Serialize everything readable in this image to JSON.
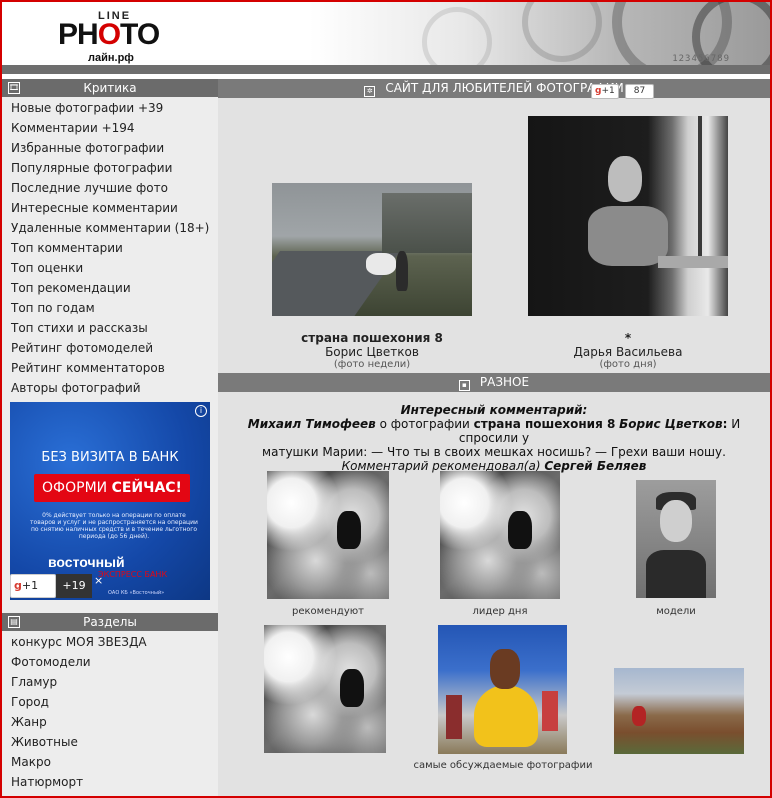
{
  "header": {
    "logo_line": "LINE",
    "logo_photo_left": "PH",
    "logo_photo_o": "O",
    "logo_photo_right": "TO",
    "logo_domain": "лайн.рф",
    "header_numbers": "123456789"
  },
  "sidebar": {
    "critique_title": "Критика",
    "critique_items": [
      "Новые фотографии +39",
      "Комментарии +194",
      "Избранные фотографии",
      "Популярные фотографии",
      "Последние лучшие фото",
      "Интересные комментарии",
      "Удаленные комментарии (18+)",
      "Топ комментарии",
      "Топ оценки",
      "Топ рекомендации",
      "Топ по годам",
      "Топ стихи и рассказы",
      "Рейтинг фотомоделей",
      "Рейтинг комментаторов",
      "Авторы фотографий"
    ],
    "sections_title": "Разделы",
    "section_items": [
      "конкурс МОЯ ЗВЕЗДА",
      "Фотомодели",
      "Гламур",
      "Город",
      "Жанр",
      "Животные",
      "Макро",
      "Натюрморт"
    ]
  },
  "ad": {
    "headline": "БЕЗ ВИЗИТА В БАНК",
    "button_normal": "ОФОРМИ ",
    "button_bold": "СЕЙЧАС!",
    "fine_print": "0% действует только на операции по оплате товаров и услуг и не распространяется на операции по снятию наличных средств и в течение льготного периода (до 56 дней).",
    "brand": "восточный",
    "brand_sub": "ЭКСПРЕСС БАНК",
    "gplus_label": "+1",
    "gplus_count": "+19",
    "close_symbol": "×",
    "info_symbol": "i",
    "legal": "ОАО КБ «Восточный»"
  },
  "main": {
    "top_title": "САЙТ ДЛЯ ЛЮБИТЕЛЕЙ ФОТОГРАФИИ",
    "share_label": "+1",
    "share_count": "87",
    "photo_week": {
      "title": "страна пошехония 8",
      "author": "Борис Цветков",
      "label": "(фото недели)"
    },
    "photo_day": {
      "title": "*",
      "author": "Дарья Васильева",
      "label": "(фото дня)"
    },
    "misc_title": "РАЗНОЕ",
    "interesting": {
      "heading": "Интересный комментарий:",
      "commenter": "Михаил Тимофеев",
      "about": " о фотографии ",
      "photo": "страна пошехония 8",
      "photo_author": "Борис Цветков",
      "text_1": " И спросили у",
      "text_2": "матушки Марии: — Что ты в своих мешках носишь? — Грехи ваши ношу.",
      "recommended": "Комментарий рекомендовал(а) ",
      "recommender": "Сергей Беляев"
    },
    "thumb_captions": {
      "recommend": "рекомендуют",
      "leader": "лидер дня",
      "models": "модели",
      "discussed": "самые обсуждаемые фотографии"
    }
  },
  "icons": {
    "critique_icon": "🎞",
    "sections_icon": "▤",
    "top_icon": "✲",
    "misc_icon": "▪"
  }
}
